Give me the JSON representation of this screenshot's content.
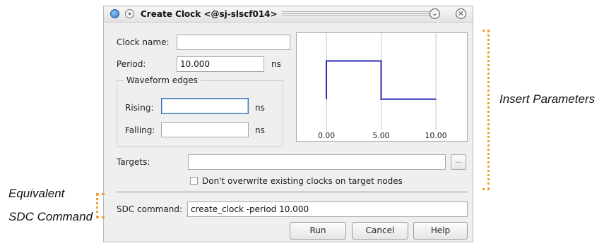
{
  "window": {
    "title": "Create Clock <@sj-slscf014>"
  },
  "form": {
    "clock_name_label": "Clock name:",
    "clock_name_value": "",
    "period_label": "Period:",
    "period_value": "10.000",
    "period_unit": "ns",
    "waveform_group_label": "Waveform edges",
    "rising_label": "Rising:",
    "rising_value": "",
    "rising_unit": "ns",
    "falling_label": "Falling:",
    "falling_value": "",
    "falling_unit": "ns",
    "targets_label": "Targets:",
    "targets_value": "",
    "browse_label": "...",
    "overwrite_checkbox_label": "Don't overwrite existing clocks on target nodes",
    "overwrite_checked": false,
    "sdc_label": "SDC command:",
    "sdc_value": "create_clock -period 10.000"
  },
  "buttons": {
    "run": "Run",
    "cancel": "Cancel",
    "help": "Help"
  },
  "annotations": {
    "insert_parameters": "Insert Parameters",
    "equivalent_line1": "Equivalent",
    "equivalent_line2": "SDC Command"
  },
  "colors": {
    "accent": "#f0a030",
    "waveform": "#2b2bb3",
    "focus": "#3b6fb6"
  },
  "chart_data": {
    "type": "line",
    "x_ticks": [
      "0.00",
      "5.00",
      "10.00"
    ],
    "xlim": [
      0,
      10
    ],
    "levels": [
      "low",
      "high"
    ],
    "series": [
      {
        "x": [
          0,
          0,
          5,
          5,
          10
        ],
        "y": [
          "low",
          "high",
          "high",
          "low",
          "low"
        ]
      }
    ]
  }
}
